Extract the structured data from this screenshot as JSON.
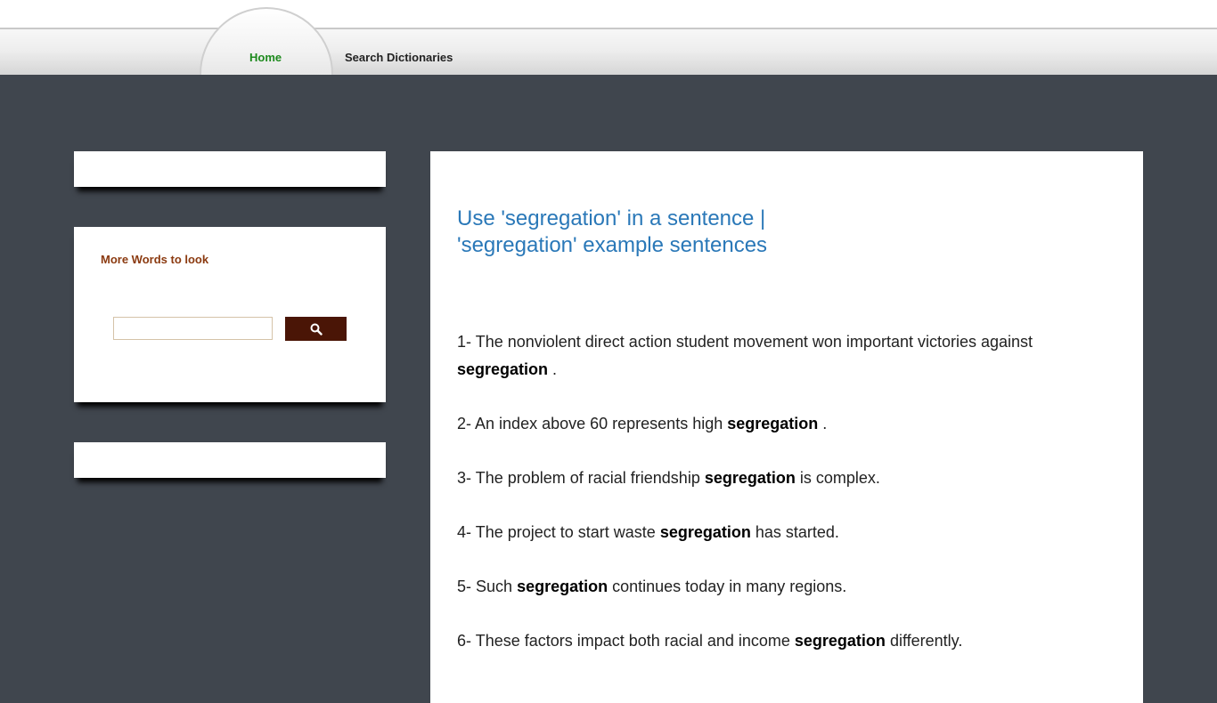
{
  "nav": {
    "home_label": "Home",
    "search_label": "Search Dictionaries"
  },
  "sidebar": {
    "more_words_title": "More Words to look",
    "search": {
      "placeholder": "",
      "value": ""
    }
  },
  "main": {
    "title": "Use 'segregation' in a sentence | 'segregation' example sentences",
    "keyword": "segregation",
    "sentences": [
      {
        "num": "1-",
        "before": "The nonviolent direct action student movement won important victories against",
        "after": "."
      },
      {
        "num": "2-",
        "before": "An index above 60 represents high",
        "after": "."
      },
      {
        "num": "3-",
        "before": "The problem of racial friendship",
        "after": "is complex."
      },
      {
        "num": "4-",
        "before": "The project to start waste",
        "after": "has started."
      },
      {
        "num": "5-",
        "before": "Such",
        "after": "continues today in many regions."
      },
      {
        "num": "6-",
        "before": "These factors impact both racial and income",
        "after": "differently."
      }
    ]
  },
  "colors": {
    "page_background": "#40464e",
    "home_link": "#1d8a1d",
    "title_blue": "#2a78b8",
    "sidebar_heading": "#8b3a10",
    "search_button": "#4a1506"
  },
  "icons": {
    "search_button_icon": "search-icon"
  }
}
